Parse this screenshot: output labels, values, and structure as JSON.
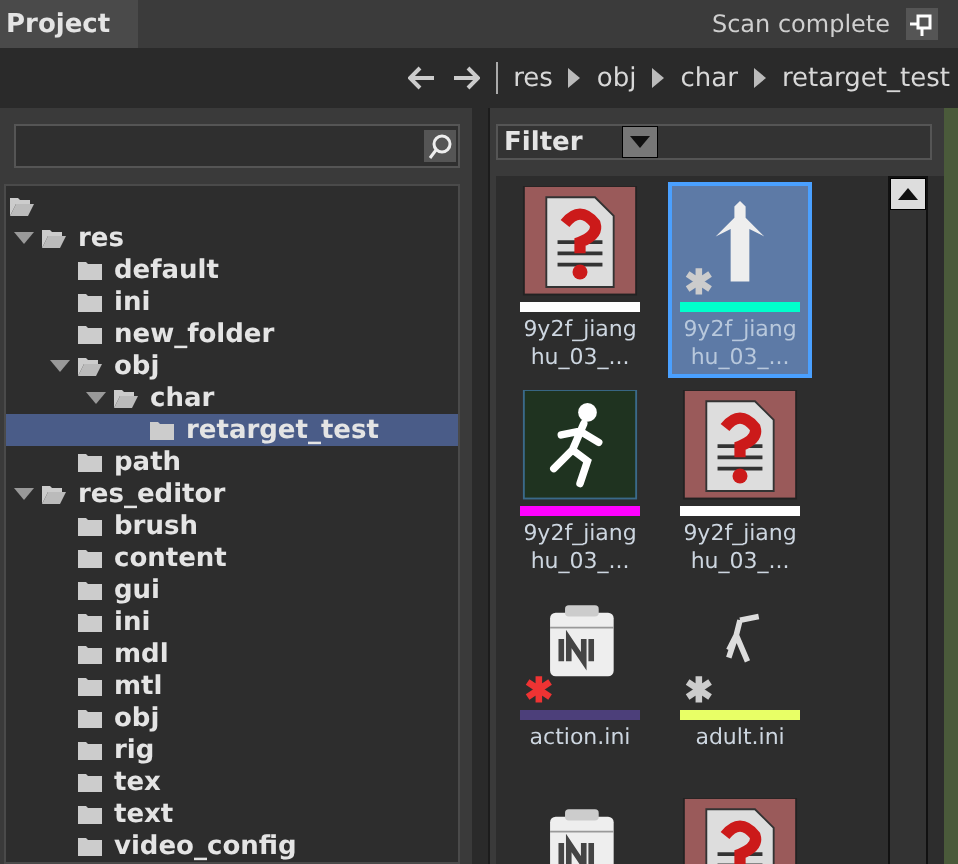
{
  "panel_tab": {
    "title": "Project"
  },
  "toolbar": {
    "breadcrumb": [
      "res",
      "obj",
      "char",
      "retarget_test"
    ],
    "status": "Scan complete"
  },
  "tree": {
    "expanded": true,
    "children": [
      {
        "label": "res",
        "expanded": true,
        "selected": false,
        "children": [
          {
            "label": "default",
            "selected": false
          },
          {
            "label": "ini",
            "selected": false
          },
          {
            "label": "new_folder",
            "selected": false
          },
          {
            "label": "obj",
            "expanded": true,
            "selected": false,
            "children": [
              {
                "label": "char",
                "expanded": true,
                "selected": false,
                "children": [
                  {
                    "label": "retarget_test",
                    "selected": true
                  }
                ]
              }
            ]
          },
          {
            "label": "path",
            "selected": false
          }
        ]
      },
      {
        "label": "res_editor",
        "expanded": true,
        "selected": false,
        "children": [
          {
            "label": "brush",
            "selected": false
          },
          {
            "label": "content",
            "selected": false
          },
          {
            "label": "gui",
            "selected": false
          },
          {
            "label": "ini",
            "selected": false
          },
          {
            "label": "mdl",
            "selected": false
          },
          {
            "label": "mtl",
            "selected": false
          },
          {
            "label": "obj",
            "selected": false
          },
          {
            "label": "rig",
            "selected": false
          },
          {
            "label": "tex",
            "selected": false
          },
          {
            "label": "text",
            "selected": false
          },
          {
            "label": "video_config",
            "selected": false
          }
        ]
      }
    ]
  },
  "filter": {
    "label": "Filter"
  },
  "files": [
    {
      "kind": "unknown",
      "name": "9y2f_jianghu_03_...",
      "color": "#ffffff",
      "selected": false
    },
    {
      "kind": "model",
      "name": "9y2f_jianghu_03_...",
      "color": "#00ffcc",
      "asterisk": {
        "color": "#cccccc"
      },
      "selected": true
    },
    {
      "kind": "anim",
      "name": "9y2f_jianghu_03_...",
      "color": "#ff00ff",
      "selected": false
    },
    {
      "kind": "unknown",
      "name": "9y2f_jianghu_03_...",
      "color": "#ffffff",
      "selected": false
    },
    {
      "kind": "ini",
      "name": "action.ini",
      "color": "#4c3f7a",
      "asterisk": {
        "color": "#ee3333"
      },
      "selected": false
    },
    {
      "kind": "figure",
      "name": "adult.ini",
      "color": "#e8ff66",
      "asterisk": {
        "color": "#cccccc"
      },
      "selected": false
    },
    {
      "kind": "ini",
      "selected": false
    },
    {
      "kind": "unknown",
      "selected": false
    }
  ]
}
